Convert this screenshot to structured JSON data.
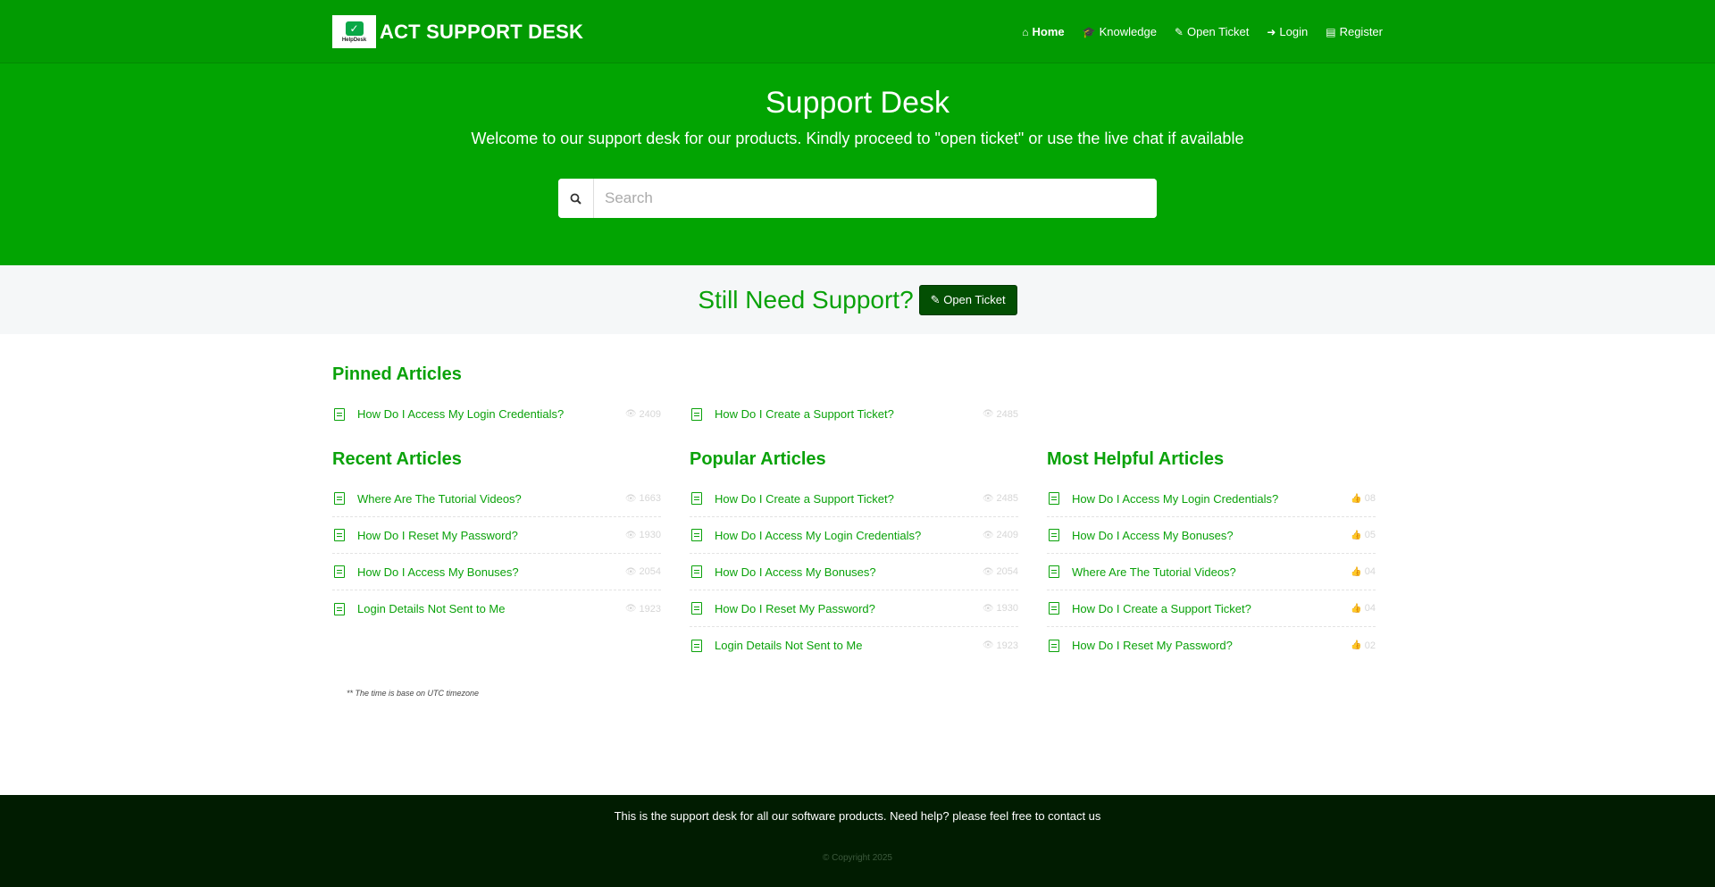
{
  "brand": {
    "logo_text": "HelpDesk",
    "name": "ACT SUPPORT DESK"
  },
  "nav": [
    {
      "label": "Home",
      "icon": "home-icon",
      "glyph": "⌂"
    },
    {
      "label": "Knowledge",
      "icon": "graduation-cap-icon",
      "glyph": "🎓"
    },
    {
      "label": "Open Ticket",
      "icon": "ticket-icon",
      "glyph": "✎"
    },
    {
      "label": "Login",
      "icon": "sign-in-icon",
      "glyph": "➜"
    },
    {
      "label": "Register",
      "icon": "register-icon",
      "glyph": "▤"
    }
  ],
  "hero": {
    "title": "Support Desk",
    "subtitle": "Welcome to our support desk for our products. Kindly proceed to \"open ticket\" or use the live chat if available",
    "search_placeholder": "Search"
  },
  "support": {
    "text": "Still Need Support?",
    "button": "Open Ticket"
  },
  "pinned": {
    "title": "Pinned Articles",
    "items": [
      {
        "title": "How Do I Access My Login Credentials?",
        "views": "2409"
      },
      {
        "title": "How Do I Create a Support Ticket?",
        "views": "2485"
      }
    ]
  },
  "recent": {
    "title": "Recent Articles",
    "items": [
      {
        "title": "Where Are The Tutorial Videos?",
        "views": "1663"
      },
      {
        "title": "How Do I Reset My Password?",
        "views": "1930"
      },
      {
        "title": "How Do I Access My Bonuses?",
        "views": "2054"
      },
      {
        "title": "Login Details Not Sent to Me",
        "views": "1923"
      }
    ]
  },
  "popular": {
    "title": "Popular Articles",
    "items": [
      {
        "title": "How Do I Create a Support Ticket?",
        "views": "2485"
      },
      {
        "title": "How Do I Access My Login Credentials?",
        "views": "2409"
      },
      {
        "title": "How Do I Access My Bonuses?",
        "views": "2054"
      },
      {
        "title": "How Do I Reset My Password?",
        "views": "1930"
      },
      {
        "title": "Login Details Not Sent to Me",
        "views": "1923"
      }
    ]
  },
  "helpful": {
    "title": "Most Helpful Articles",
    "items": [
      {
        "title": "How Do I Access My Login Credentials?",
        "likes": "08"
      },
      {
        "title": "How Do I Access My Bonuses?",
        "likes": "05"
      },
      {
        "title": "Where Are The Tutorial Videos?",
        "likes": "04"
      },
      {
        "title": "How Do I Create a Support Ticket?",
        "likes": "04"
      },
      {
        "title": "How Do I Reset My Password?",
        "likes": "02"
      }
    ]
  },
  "tz_note": "** The time is base on UTC timezone",
  "footer": {
    "text": "This is the support desk for all our software products. Need help? please feel free to contact us",
    "copyright": "© Copyright 2025"
  },
  "colors": {
    "nav_bg": "#029b02",
    "hero_bg": "#02a402",
    "accent": "#0aa20a",
    "footer_bg": "#011c01",
    "button_bg": "#034f03"
  }
}
